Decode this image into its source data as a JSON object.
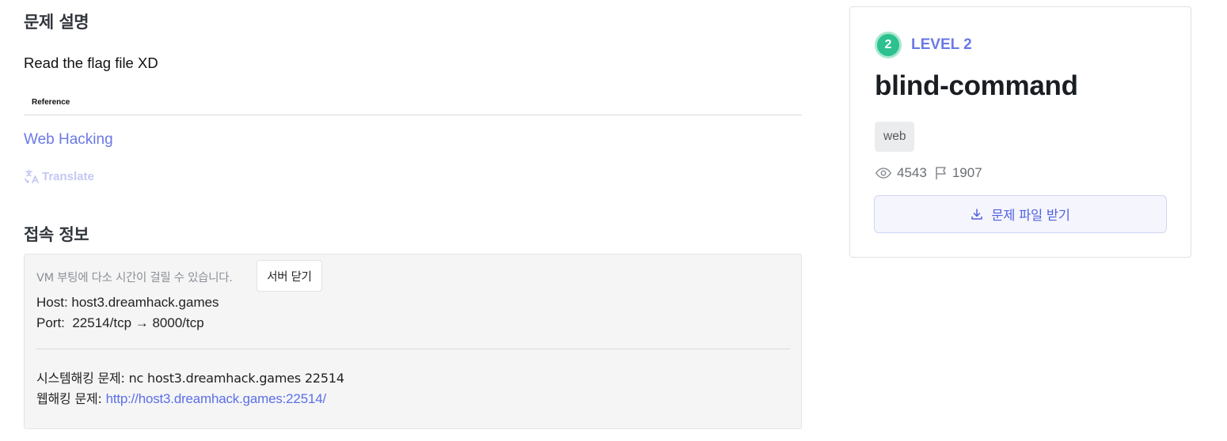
{
  "description": {
    "title": "문제 설명",
    "text": "Read the flag file XD",
    "reference_label": "Reference",
    "reference_link": "Web Hacking",
    "translate_label": "Translate"
  },
  "connection": {
    "title": "접속 정보",
    "vm_note": "VM 부팅에 다소 시간이 걸릴 수 있습니다.",
    "close_button": "서버 닫기",
    "host_line": "Host: host3.dreamhack.games",
    "port_line": "Port:  22514/tcp → 8000/tcp",
    "system_line": "시스템해킹 문제: nc host3.dreamhack.games 22514",
    "web_prefix": "웹해킹 문제: ",
    "web_url": "http://host3.dreamhack.games:22514/"
  },
  "challenge": {
    "level_number": "2",
    "level_label": "LEVEL 2",
    "title": "blind-command",
    "tag": "web",
    "views": "4543",
    "solves": "1907",
    "download_button": "문제 파일 받기"
  },
  "colors": {
    "accent": "#6a79e6",
    "level_badge": "#2cc18e",
    "link": "#5b6fe6"
  },
  "icons": [
    "translate-icon",
    "eye-icon",
    "flag-icon",
    "download-icon"
  ]
}
